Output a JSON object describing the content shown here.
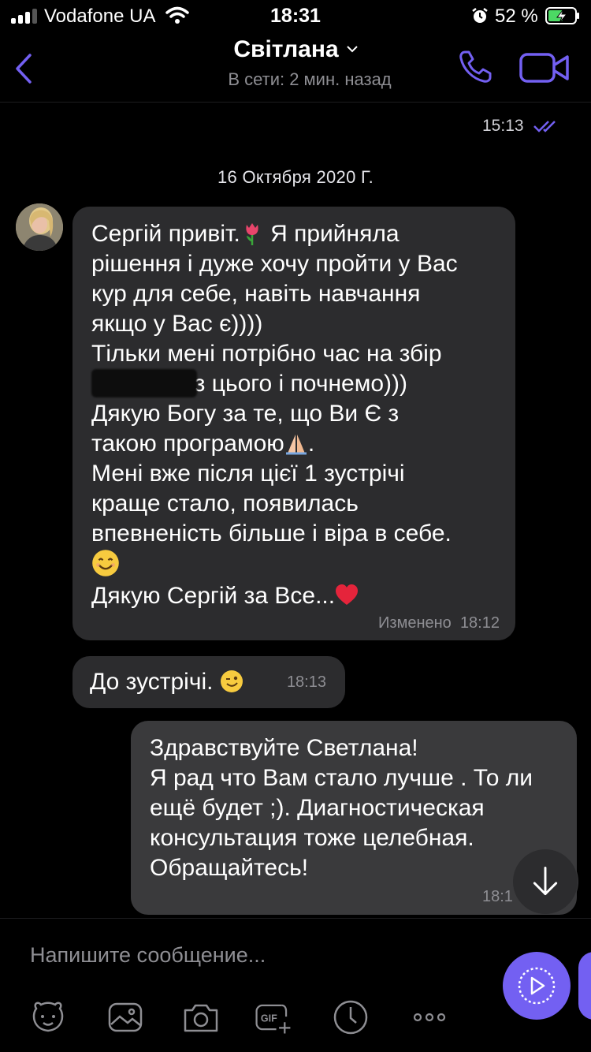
{
  "status_bar": {
    "carrier": "Vodafone UA",
    "time": "18:31",
    "battery_percent": "52 %",
    "signal_bars": 3,
    "icons": [
      "signal-icon",
      "wifi-icon",
      "alarm-icon",
      "battery-charging-icon"
    ]
  },
  "header": {
    "contact_name": "Світлана",
    "status": "В сети: 2 мин. назад",
    "icons": [
      "back-icon",
      "chevron-down-icon",
      "phone-icon",
      "video-icon"
    ]
  },
  "chat": {
    "prev_message_time": "15:13",
    "date_separator": "16 Октября 2020 Г.",
    "messages": [
      {
        "direction": "in",
        "lines": [
          "Сергій привіт.",
          " Я прийняла",
          "рішення і дуже хочу пройти у Вас",
          "кур для себе, навіть навчання",
          "якщо у Вас є))))",
          "Тільки мені потрібно час на збір",
          ". з цього і почнемо)))",
          "Дякую Богу за те, що Ви Є з",
          "такою програмою",
          ".",
          "Мені вже після цієї 1 зустрічі",
          "краще стало, появилась",
          "впевненість більше і віра в себе.",
          "Дякую Сергій за Все..."
        ],
        "edited_label": "Изменено",
        "time": "18:12"
      },
      {
        "direction": "in",
        "text": "До зустрічі.",
        "time": "18:13"
      },
      {
        "direction": "out",
        "lines": [
          "Здравствуйте Светлана!",
          "Я рад что Вам стало лучше . То ли",
          "ещё будет ;). Диагностическая",
          "консультация тоже целебная.",
          "Обращайтесь!"
        ],
        "time": "18:1"
      }
    ],
    "emojis": [
      "tulip-emoji",
      "folded-hands-emoji",
      "smiling-face-emoji",
      "red-heart-emoji",
      "winking-face-emoji"
    ]
  },
  "composer": {
    "placeholder": "Напишите сообщение...",
    "gif_label": "GIF",
    "tools": [
      "sticker-icon",
      "gallery-icon",
      "camera-icon",
      "gif-icon",
      "timer-icon",
      "more-icon"
    ],
    "accent_color": "#7360f2"
  }
}
